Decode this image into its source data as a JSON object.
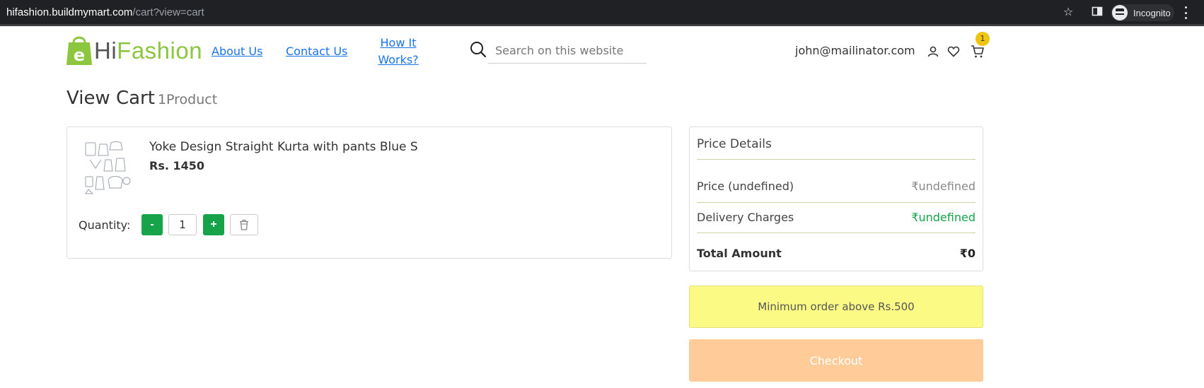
{
  "browser": {
    "url_host": "hifashion.buildmymart.com",
    "url_path": "/cart?view=cart",
    "incognito_label": "Incognito"
  },
  "header": {
    "logo_hi": "Hi",
    "logo_fashion": "Fashion",
    "logo_letter": "e",
    "nav": {
      "about": "About Us",
      "contact": "Contact Us",
      "how_line1": "How It",
      "how_line2": "Works?"
    },
    "search_placeholder": "Search on this website",
    "user_email": "john@mailinator.com",
    "cart_count": "1"
  },
  "page": {
    "title": "View Cart",
    "subtitle": "1Product"
  },
  "cart": {
    "items": [
      {
        "name": "Yoke Design Straight Kurta with pants Blue S",
        "price": "Rs. 1450",
        "quantity": "1"
      }
    ],
    "quantity_label": "Quantity:",
    "minus_label": "-",
    "plus_label": "+"
  },
  "price_details": {
    "heading": "Price Details",
    "price_label": "Price (undefined)",
    "price_value": "₹undefined",
    "delivery_label": "Delivery Charges",
    "delivery_value": "₹undefined",
    "total_label": "Total Amount",
    "total_value": "₹0"
  },
  "min_order_text": "Minimum order above Rs.500",
  "checkout_label": "Checkout",
  "colors": {
    "brand_green": "#8cc63f",
    "button_green": "#16a34a",
    "link_blue": "#1a73e8",
    "delivery_green": "#16a34a",
    "min_order_bg": "#fbfa85",
    "checkout_bg": "#ffcb99",
    "badge_yellow": "#f1c40f"
  }
}
